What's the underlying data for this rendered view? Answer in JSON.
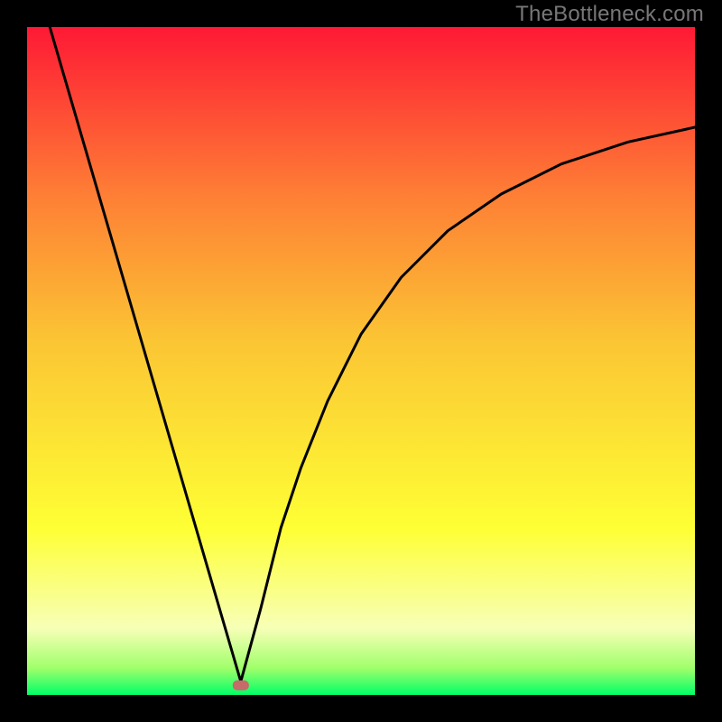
{
  "watermark": "TheBottleneck.com",
  "chart_data": {
    "type": "line",
    "title": "",
    "xlabel": "",
    "ylabel": "",
    "xlim": [
      0,
      1
    ],
    "ylim": [
      0,
      1
    ],
    "background_gradient": {
      "top": "#fe1935",
      "mid_upper": "#fe7e35",
      "mid": "#fbc534",
      "mid_lower": "#feff34",
      "lower": "#f7ffb7",
      "near_bottom": "#a0ff6b",
      "bottom": "#00ff67"
    },
    "series": [
      {
        "name": "left-branch",
        "description": "steep line from top-left down to valley",
        "x": [
          0.034,
          0.32
        ],
        "y": [
          1.0,
          0.02
        ]
      },
      {
        "name": "right-branch",
        "description": "curve rising from valley toward upper-right asymptote",
        "x": [
          0.32,
          0.35,
          0.38,
          0.41,
          0.45,
          0.5,
          0.56,
          0.63,
          0.71,
          0.8,
          0.9,
          1.0
        ],
        "y": [
          0.02,
          0.13,
          0.25,
          0.34,
          0.44,
          0.54,
          0.625,
          0.695,
          0.75,
          0.795,
          0.828,
          0.85
        ]
      }
    ],
    "marker": {
      "name": "valley-point",
      "x": 0.32,
      "y": 0.015,
      "color": "#c76a6a",
      "shape": "rounded-rect"
    }
  }
}
